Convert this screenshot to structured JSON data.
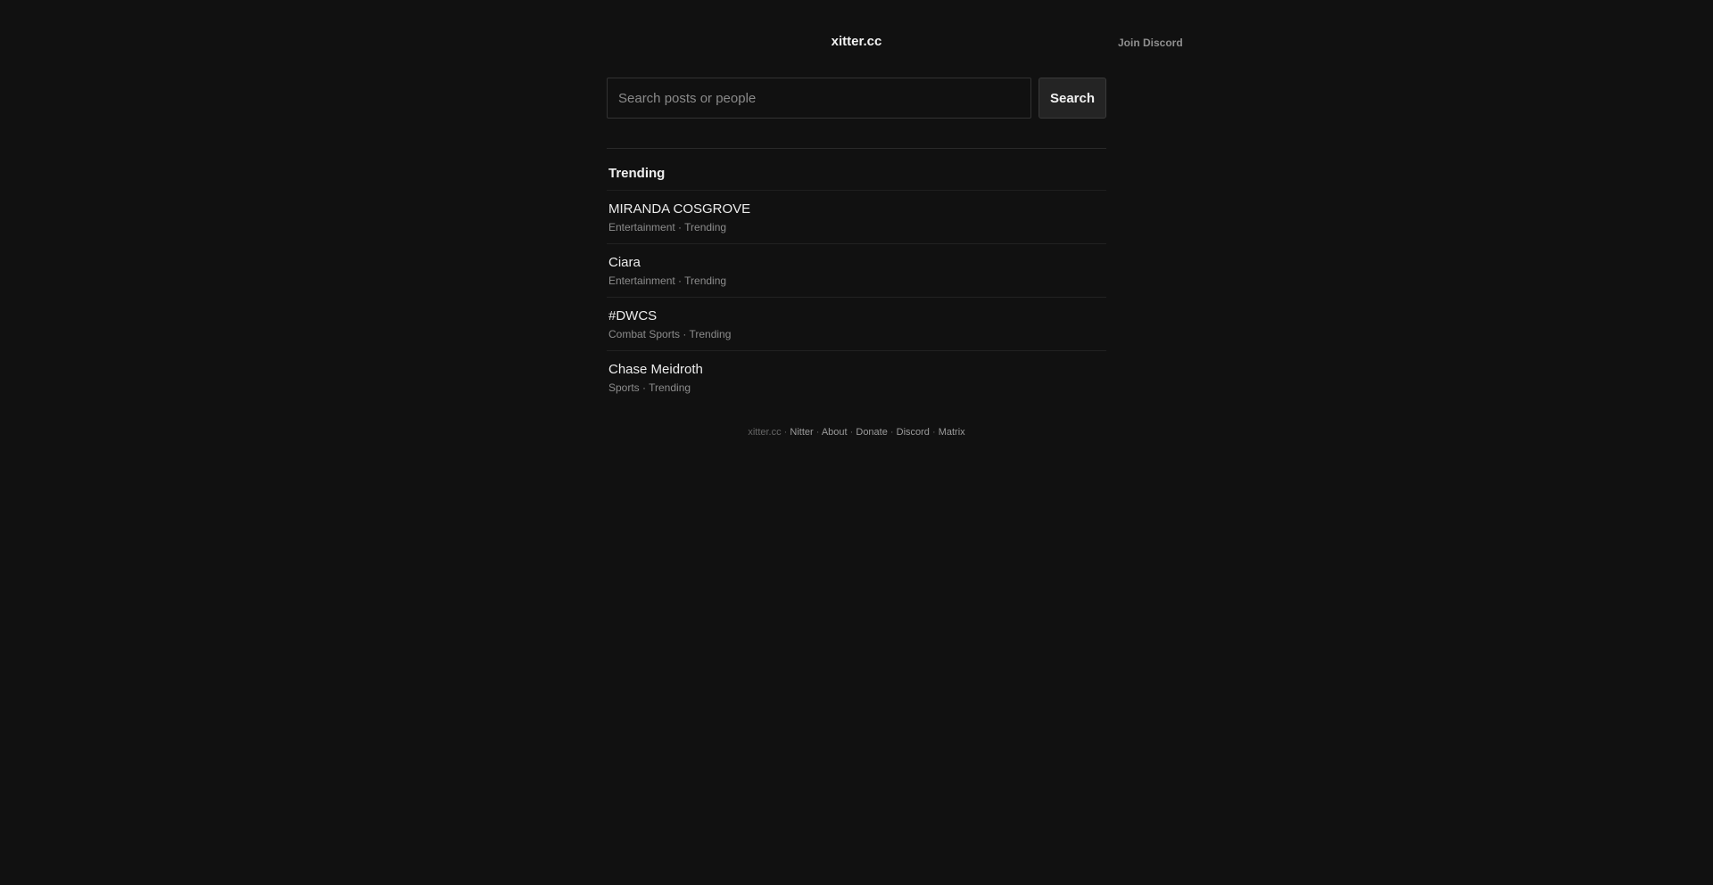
{
  "header": {
    "title": "xitter.cc",
    "join_discord": "Join Discord"
  },
  "search": {
    "placeholder": "Search posts or people",
    "value": "",
    "button_label": "Search"
  },
  "trending": {
    "title": "Trending",
    "items": [
      {
        "name": "MIRANDA COSGROVE",
        "meta": "Entertainment · Trending"
      },
      {
        "name": "Ciara",
        "meta": "Entertainment · Trending"
      },
      {
        "name": "#DWCS",
        "meta": "Combat Sports · Trending"
      },
      {
        "name": "Chase Meidroth",
        "meta": "Sports · Trending"
      }
    ]
  },
  "footer": {
    "site": "xitter.cc",
    "separator": " · ",
    "links": [
      "Nitter",
      "About",
      "Donate",
      "Discord",
      "Matrix"
    ]
  },
  "colors": {
    "background": "#111111",
    "text": "#e7e7e7",
    "muted": "#8c8c8c"
  }
}
